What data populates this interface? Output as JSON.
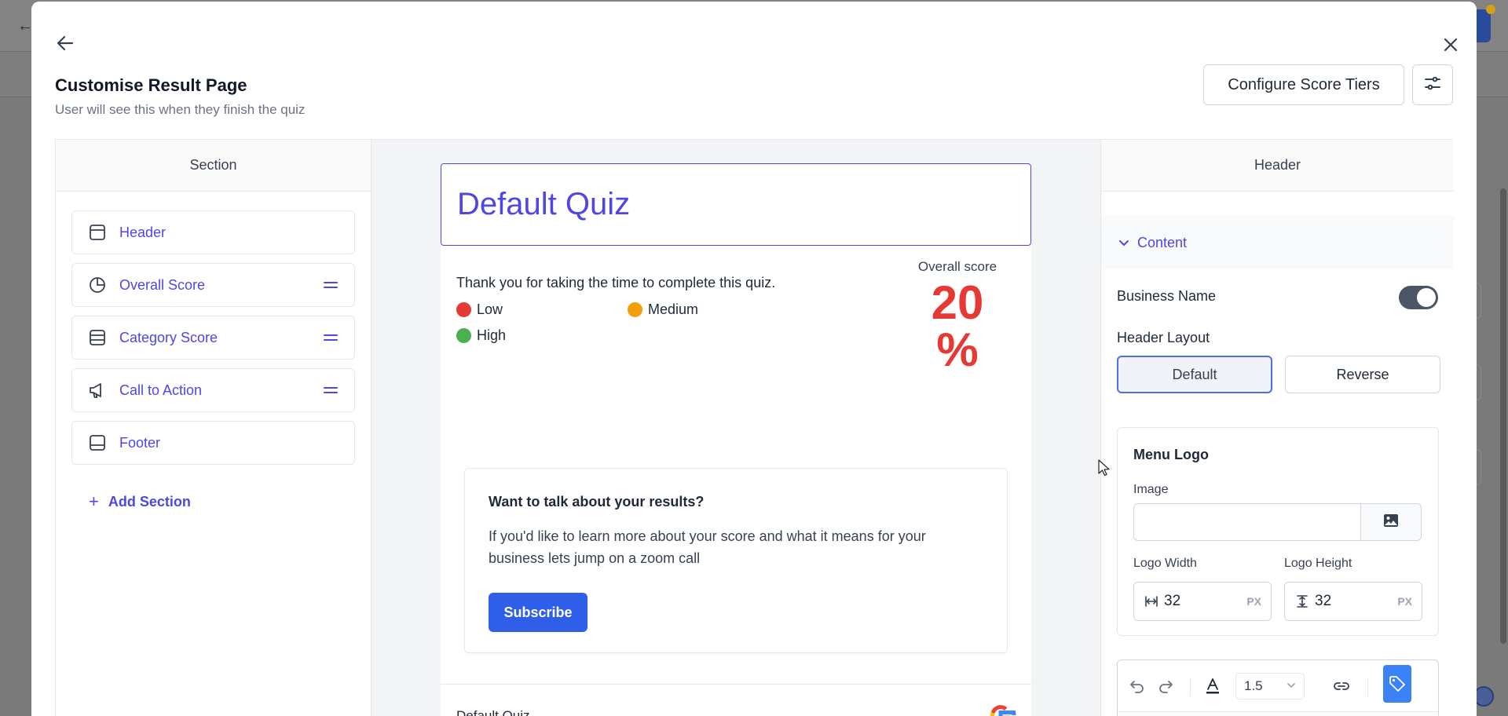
{
  "modal": {
    "title": "Customise Result Page",
    "subtitle": "User will see this when they finish the quiz",
    "configure_label": "Configure Score Tiers"
  },
  "section_panel": {
    "heading": "Section",
    "items": [
      {
        "label": "Header",
        "icon": "layout-header-icon",
        "draggable": false
      },
      {
        "label": "Overall Score",
        "icon": "pie-chart-icon",
        "draggable": true
      },
      {
        "label": "Category Score",
        "icon": "list-rows-icon",
        "draggable": true
      },
      {
        "label": "Call to Action",
        "icon": "megaphone-icon",
        "draggable": true
      },
      {
        "label": "Footer",
        "icon": "layout-footer-icon",
        "draggable": false
      }
    ],
    "add_label": "Add Section"
  },
  "preview": {
    "header_title": "Default Quiz",
    "thanks_text": "Thank you for taking the time to complete this quiz.",
    "legend": [
      {
        "label": "Low",
        "color": "#e53935"
      },
      {
        "label": "Medium",
        "color": "#f59e0b"
      },
      {
        "label": "High",
        "color": "#4caf50"
      }
    ],
    "score_label": "Overall score",
    "score_number": "20",
    "score_unit": "%",
    "score_color": "#e53935",
    "cta": {
      "title": "Want to talk about your results?",
      "body": "If you'd like to learn more about your score and what it means for your business lets jump on a zoom call",
      "button_label": "Subscribe"
    },
    "footer_title": "Default Quiz"
  },
  "settings_panel": {
    "heading": "Header",
    "accordion_label": "Content",
    "business_name_label": "Business Name",
    "business_name_enabled": true,
    "header_layout_label": "Header Layout",
    "layout_options": [
      "Default",
      "Reverse"
    ],
    "layout_selected": "Default",
    "menu_logo": {
      "title": "Menu Logo",
      "image_label": "Image",
      "image_value": "",
      "width_label": "Logo Width",
      "width_value": "32",
      "height_label": "Logo Height",
      "height_value": "32",
      "unit": "PX"
    },
    "toolbar": {
      "line_height": "1.5"
    }
  },
  "colors": {
    "accent": "#4f46e5",
    "primary_button": "#2f5ee8",
    "score_red": "#e53935"
  }
}
